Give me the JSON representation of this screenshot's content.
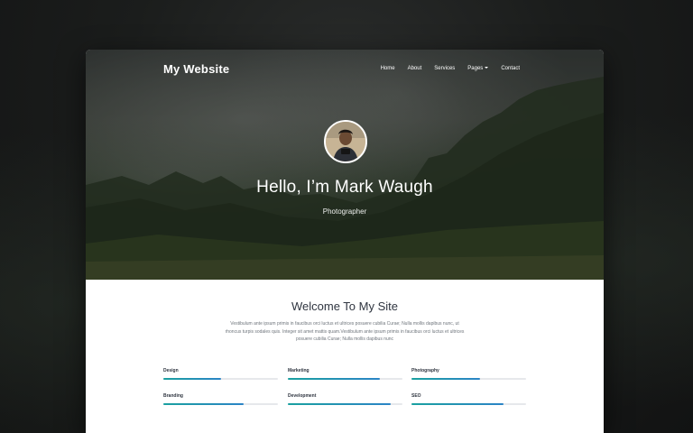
{
  "brand": "My Website",
  "nav": {
    "items": [
      {
        "label": "Home",
        "name": "nav-home"
      },
      {
        "label": "About",
        "name": "nav-about"
      },
      {
        "label": "Services",
        "name": "nav-services"
      },
      {
        "label": "Pages",
        "name": "nav-pages",
        "dropdown": true
      },
      {
        "label": "Contact",
        "name": "nav-contact"
      }
    ]
  },
  "hero": {
    "title": "Hello, I’m Mark Waugh",
    "subtitle": "Photographer"
  },
  "welcome": {
    "title": "Welcome To My Site",
    "body": "Vestibulum ante ipsum primis in faucibus orci luctus et ultrices posuere cubilia Curae; Nulla mollis dapibus nunc, ut rhoncus turpis sodales quis. Integer sit amet mattis quam.Vestibulum ante ipsum primis in faucibus orci luctus et ultrices posuere cubilia Curae; Nulla mollis dapibus nunc"
  },
  "skills": [
    {
      "label": "Design",
      "level": 0.5
    },
    {
      "label": "Marketing",
      "level": 0.8
    },
    {
      "label": "Photography",
      "level": 0.6
    },
    {
      "label": "Branding",
      "level": 0.7
    },
    {
      "label": "Development",
      "level": 0.9
    },
    {
      "label": "SEO",
      "level": 0.8
    }
  ],
  "colors": {
    "skill_fill_start": "#1aa0a0",
    "skill_fill_end": "#2b84c6",
    "heading": "#2f3540",
    "body_text": "#6f757c"
  }
}
